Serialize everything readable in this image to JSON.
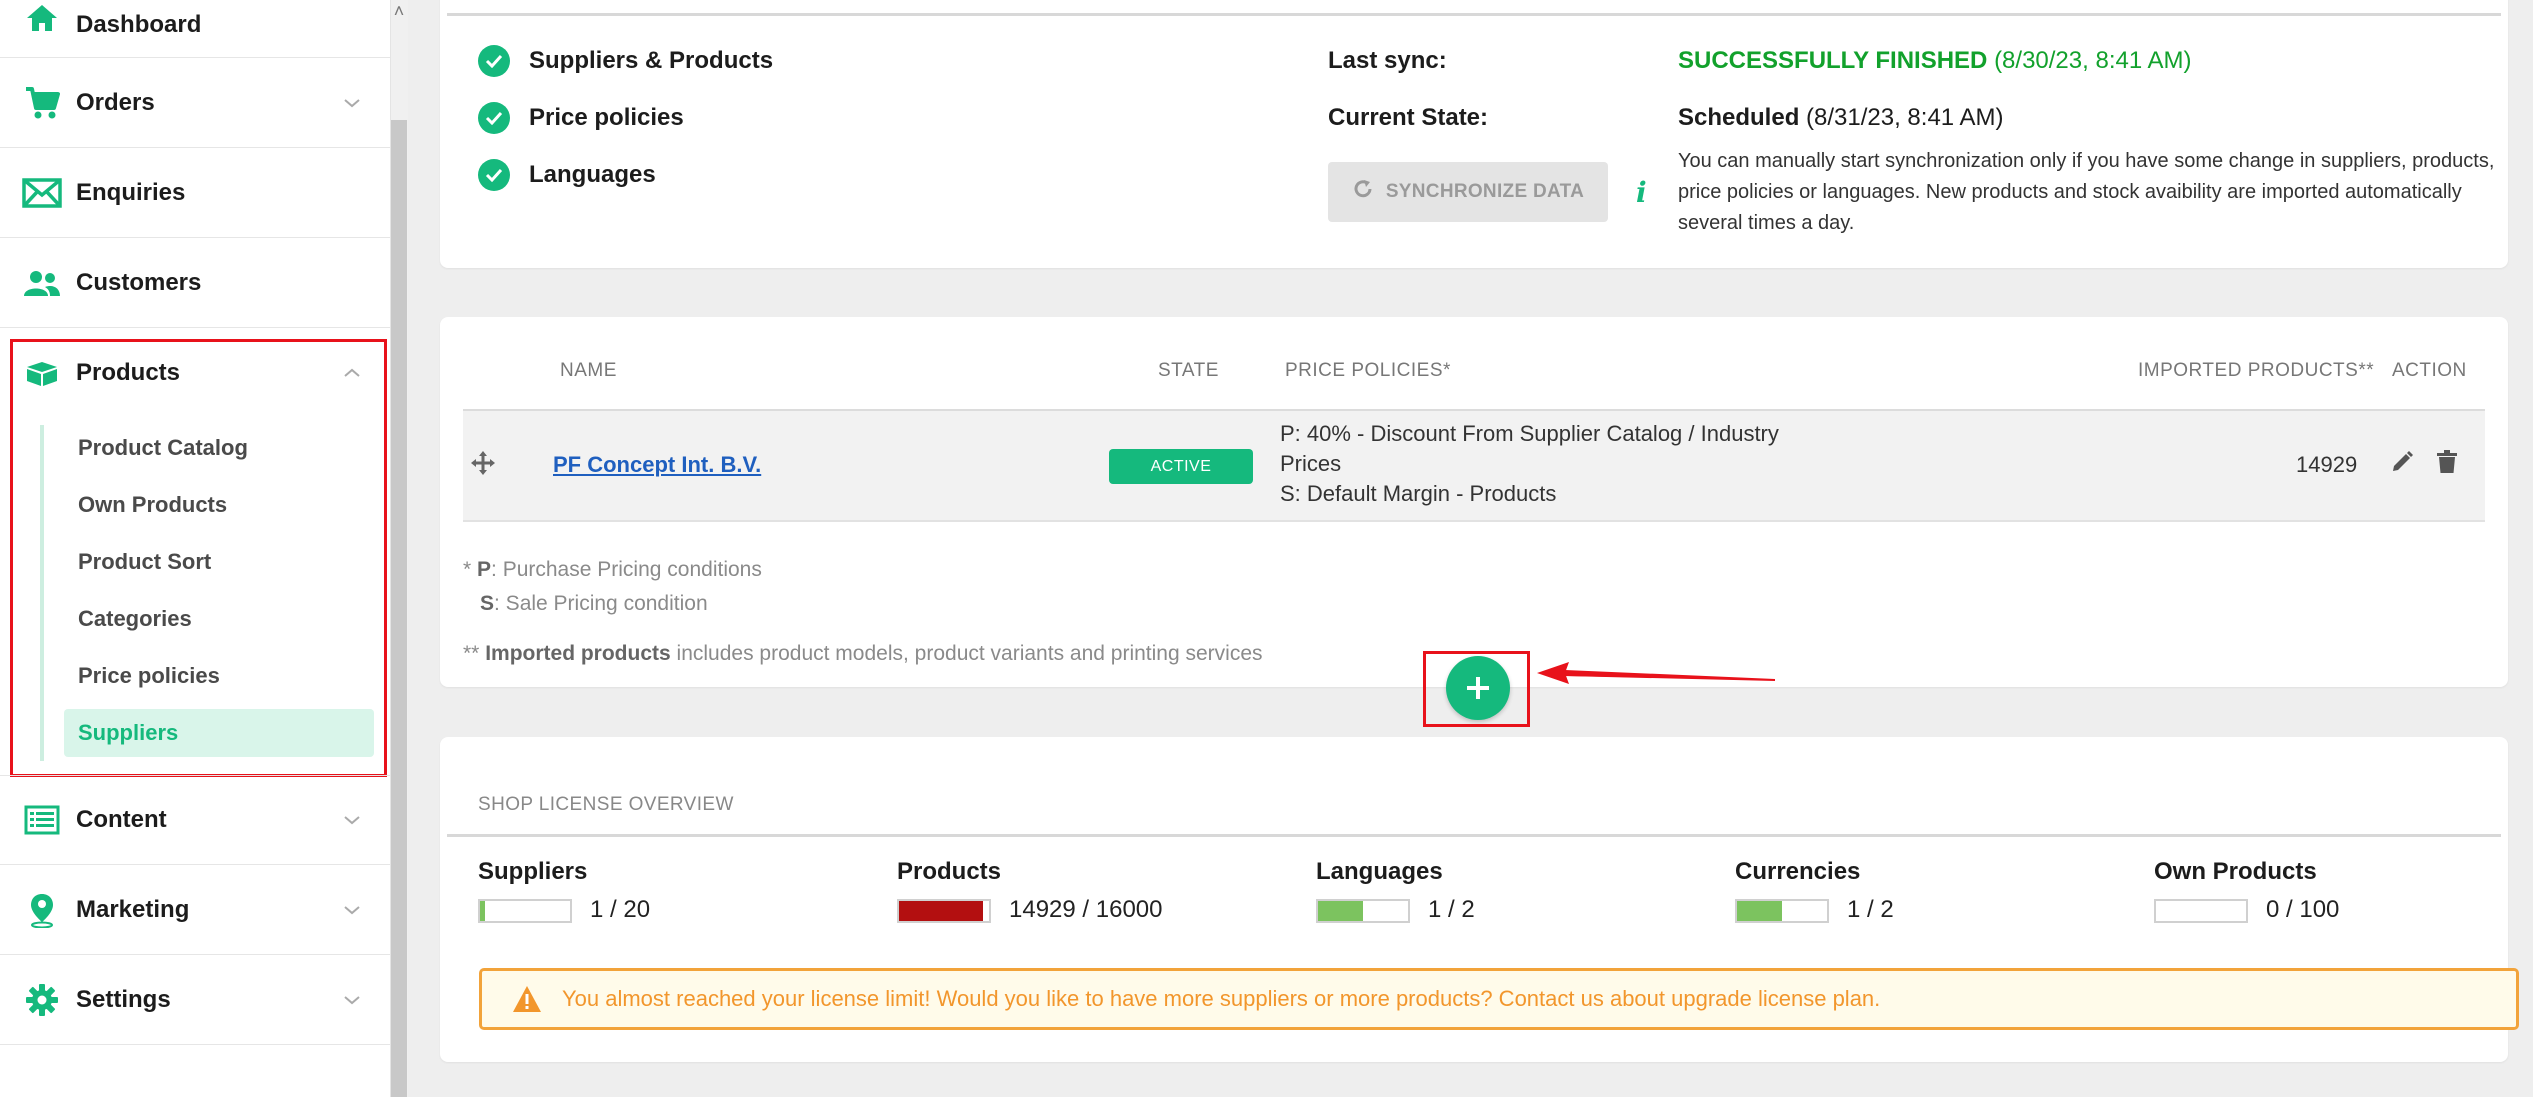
{
  "sidebar": {
    "items": [
      {
        "label": "Dashboard"
      },
      {
        "label": "Orders"
      },
      {
        "label": "Enquiries"
      },
      {
        "label": "Customers"
      },
      {
        "label": "Products"
      },
      {
        "label": "Content"
      },
      {
        "label": "Marketing"
      },
      {
        "label": "Settings"
      }
    ],
    "products_sub": [
      {
        "label": "Product Catalog"
      },
      {
        "label": "Own Products"
      },
      {
        "label": "Product Sort"
      },
      {
        "label": "Categories"
      },
      {
        "label": "Price policies"
      },
      {
        "label": "Suppliers"
      }
    ]
  },
  "sync": {
    "checks": [
      "Suppliers & Products",
      "Price policies",
      "Languages"
    ],
    "last_sync_label": "Last sync:",
    "last_sync_status": "SUCCESSFULLY FINISHED",
    "last_sync_time": "(8/30/23, 8:41 AM)",
    "current_state_label": "Current State:",
    "current_state_status": "Scheduled",
    "current_state_time": "(8/31/23, 8:41 AM)",
    "button_label": "SYNCHRONIZE DATA",
    "note": "You can manually start synchronization only if you have some change in suppliers, products, price policies or languages. New products and stock avaibility are imported automatically several times a day."
  },
  "table": {
    "headers": {
      "name": "NAME",
      "state": "STATE",
      "price_policies": "PRICE POLICIES*",
      "imported": "IMPORTED PRODUCTS**",
      "action": "ACTION"
    },
    "rows": [
      {
        "name": "PF Concept Int. B.V.",
        "state": "ACTIVE",
        "pp_line1": "P: 40% - Discount From Supplier Catalog / Industry",
        "pp_line2": "Prices",
        "pp_line3": "S: Default Margin - Products",
        "imported": "14929"
      }
    ],
    "legend": {
      "p_prefix": "* ",
      "p_key": "P",
      "p_text": ": Purchase Pricing conditions",
      "s_key": "S",
      "s_text": ": Sale Pricing condition",
      "imp_prefix": "** ",
      "imp_key": "Imported products",
      "imp_text": " includes product models, product variants and printing services"
    },
    "add_label": "+"
  },
  "license": {
    "title": "SHOP LICENSE OVERVIEW",
    "items": [
      {
        "name": "Suppliers",
        "value": "1 / 20",
        "fill": 0.05,
        "color": "#7cc35f"
      },
      {
        "name": "Products",
        "value": "14929 / 16000",
        "fill": 0.93,
        "color": "#b30f10"
      },
      {
        "name": "Languages",
        "value": "1 / 2",
        "fill": 0.5,
        "color": "#7cc35f"
      },
      {
        "name": "Currencies",
        "value": "1 / 2",
        "fill": 0.5,
        "color": "#7cc35f"
      },
      {
        "name": "Own Products",
        "value": "0 / 100",
        "fill": 0,
        "color": "#7cc35f"
      }
    ],
    "warning": "You almost reached your license limit! Would you like to have more suppliers or more products? Contact us about upgrade license plan."
  },
  "colors": {
    "accent": "#15b97d",
    "highlight": "#e8121b",
    "warning": "#f2962c"
  }
}
